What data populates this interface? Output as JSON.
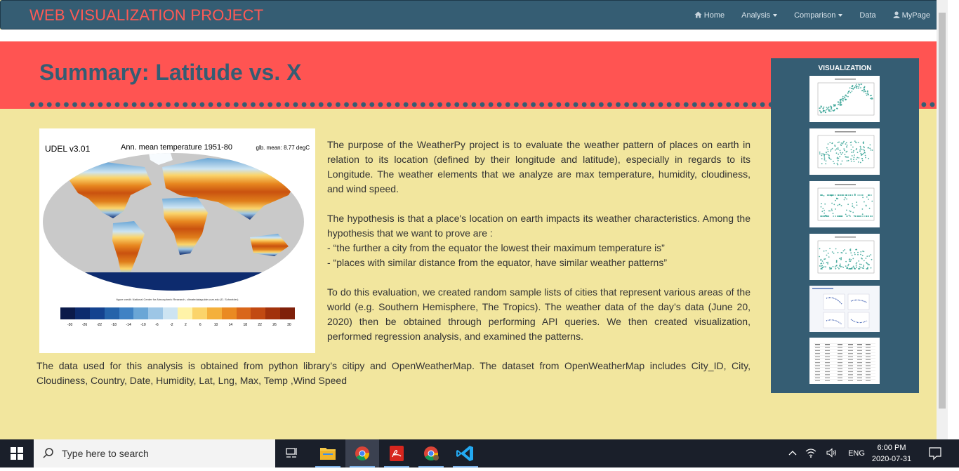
{
  "navbar": {
    "brand": "WEB VISUALIZATION PROJECT",
    "links": [
      {
        "label": "Home",
        "icon": "home-icon",
        "dropdown": false
      },
      {
        "label": "Analysis",
        "icon": null,
        "dropdown": true
      },
      {
        "label": "Comparison",
        "icon": null,
        "dropdown": true
      },
      {
        "label": "Data",
        "icon": null,
        "dropdown": false
      },
      {
        "label": "MyPage",
        "icon": "user-icon",
        "dropdown": false
      }
    ]
  },
  "page": {
    "title": "Summary: Latitude vs. X"
  },
  "map_figure": {
    "label_left": "UDEL v3.01",
    "label_center": "Ann. mean temperature 1951-80",
    "label_right": "glb. mean: 8.77 degC",
    "credit": "figure credit: National Center for Atmospheric Research, climatedataguide.ucar.edu (D. Schneider)",
    "colorbar_ticks": [
      "-30",
      "-26",
      "-22",
      "-18",
      "-14",
      "-10",
      "-6",
      "-2",
      "2",
      "6",
      "10",
      "14",
      "18",
      "22",
      "26",
      "30"
    ],
    "colorbar_colors": [
      "#0b1a4a",
      "#0d2b6e",
      "#14428f",
      "#2563aa",
      "#3f82c4",
      "#6aa6d6",
      "#9dc6e6",
      "#cde4f2",
      "#fff3a8",
      "#fbd46a",
      "#f4b03c",
      "#ea8a22",
      "#d9661a",
      "#c24a12",
      "#a2320c",
      "#7f200a"
    ]
  },
  "paragraphs": {
    "p1": "The purpose of the WeatherPy project is to evaluate the weather pattern of places on earth in relation to its location (defined by their longitude and latitude), especially in regards to its Longitude. The weather elements that we analyze are max temperature, humidity, cloudiness, and wind speed.",
    "p2_intro": "The hypothesis is that a place's location on earth impacts its weather characteristics. Among the hypothesis that we want to prove are :",
    "p2_bullet1": "- “the further a city from the equator the lowest their maximum temperature is”",
    "p2_bullet2": "- “places with similar distance from the equator, have similar weather patterns”",
    "p3": "To do this evaluation, we created random sample lists of cities that represent various areas of the world (e.g. Southern Hemisphere, The Tropics). The weather data of the day’s data (June 20, 2020) then be obtained through performing API queries. We then created visualization, performed regression analysis, and examined the patterns.",
    "data_note": "The data used for this analysis is obtained from python library’s citipy and OpenWeatherMap. The dataset from OpenWeatherMap includes City_ID, City, Cloudiness, Country, Date, Humidity, Lat, Lng, Max, Temp ,Wind Speed"
  },
  "sidebar": {
    "title": "VISUALIZATION",
    "thumbnails": [
      "latitude-vs-max-temperature-thumb",
      "latitude-vs-humidity-thumb",
      "latitude-vs-cloudiness-thumb",
      "latitude-vs-wind-speed-thumb",
      "comparison-grid-thumb",
      "data-table-thumb"
    ]
  },
  "taskbar": {
    "search_placeholder": "Type here to search",
    "language": "ENG",
    "time": "6:00 PM",
    "date": "2020-07-31"
  },
  "colors": {
    "navbar": "#355d73",
    "brand": "#ff5a55",
    "hero": "#ff5452",
    "page_bg": "#f2e69e",
    "sidebar": "#355d73",
    "title": "#355d73",
    "scatter": "#2a9d8f"
  }
}
